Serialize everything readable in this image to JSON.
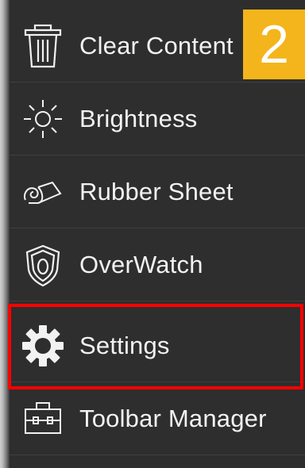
{
  "menu": {
    "items": [
      {
        "label": "Clear Content",
        "icon": "trash-icon"
      },
      {
        "label": "Brightness",
        "icon": "brightness-icon"
      },
      {
        "label": "Rubber Sheet",
        "icon": "rubber-sheet-icon"
      },
      {
        "label": "OverWatch",
        "icon": "overwatch-shield-icon"
      },
      {
        "label": "Settings",
        "icon": "gear-icon"
      },
      {
        "label": "Toolbar Manager",
        "icon": "toolbox-icon"
      }
    ]
  },
  "annotation": {
    "step_number": "2",
    "badge_color": "#f3b51b",
    "highlight_color": "#ff0000",
    "highlighted_item": "Settings"
  }
}
